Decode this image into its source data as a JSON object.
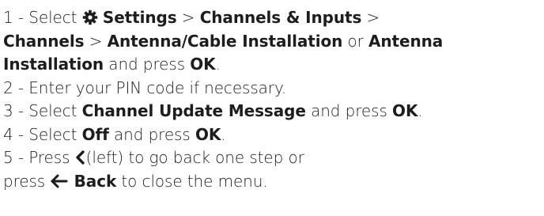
{
  "steps": [
    {
      "number": "1 -",
      "pre": "Select",
      "icon_name": "gear-icon",
      "parts": [
        {
          "text": "Settings",
          "bold": true
        },
        {
          "text": " > ",
          "bold": false
        },
        {
          "text": "Channels & Inputs",
          "bold": true
        },
        {
          "text": " >",
          "bold": false
        }
      ]
    },
    {
      "number": "",
      "parts": [
        {
          "text": "Channels",
          "bold": true
        },
        {
          "text": " > ",
          "bold": false
        },
        {
          "text": "Antenna/Cable Installation",
          "bold": true
        },
        {
          "text": " or ",
          "bold": false
        },
        {
          "text": "Antenna",
          "bold": true
        }
      ]
    },
    {
      "number": "",
      "parts": [
        {
          "text": "Installation",
          "bold": true
        },
        {
          "text": " and press ",
          "bold": false
        },
        {
          "text": "OK",
          "bold": true
        },
        {
          "text": ".",
          "bold": false
        }
      ]
    },
    {
      "number": "2 -",
      "parts": [
        {
          "text": "Enter your PIN code if necessary.",
          "bold": false
        }
      ]
    },
    {
      "number": "3 -",
      "parts": [
        {
          "text": "Select ",
          "bold": false
        },
        {
          "text": "Channel Update Message",
          "bold": true
        },
        {
          "text": " and press  ",
          "bold": false
        },
        {
          "text": "OK",
          "bold": true
        },
        {
          "text": ".",
          "bold": false
        }
      ]
    },
    {
      "number": "4 -",
      "parts": [
        {
          "text": "Select ",
          "bold": false
        },
        {
          "text": "Off",
          "bold": true
        },
        {
          "text": " and press  ",
          "bold": false
        },
        {
          "text": "OK",
          "bold": true
        },
        {
          "text": ".",
          "bold": false
        }
      ]
    },
    {
      "number": "5 -",
      "pre": "Press",
      "icon_name": "chevron-left-icon",
      "parts": [
        {
          "text": "(left) to go back one step or",
          "bold": false
        }
      ]
    },
    {
      "number": "",
      "pre": "press",
      "icon_name": "arrow-left-icon",
      "parts": [
        {
          "text": "Back",
          "bold": true
        },
        {
          "text": " to close the menu.",
          "bold": false
        }
      ]
    }
  ]
}
